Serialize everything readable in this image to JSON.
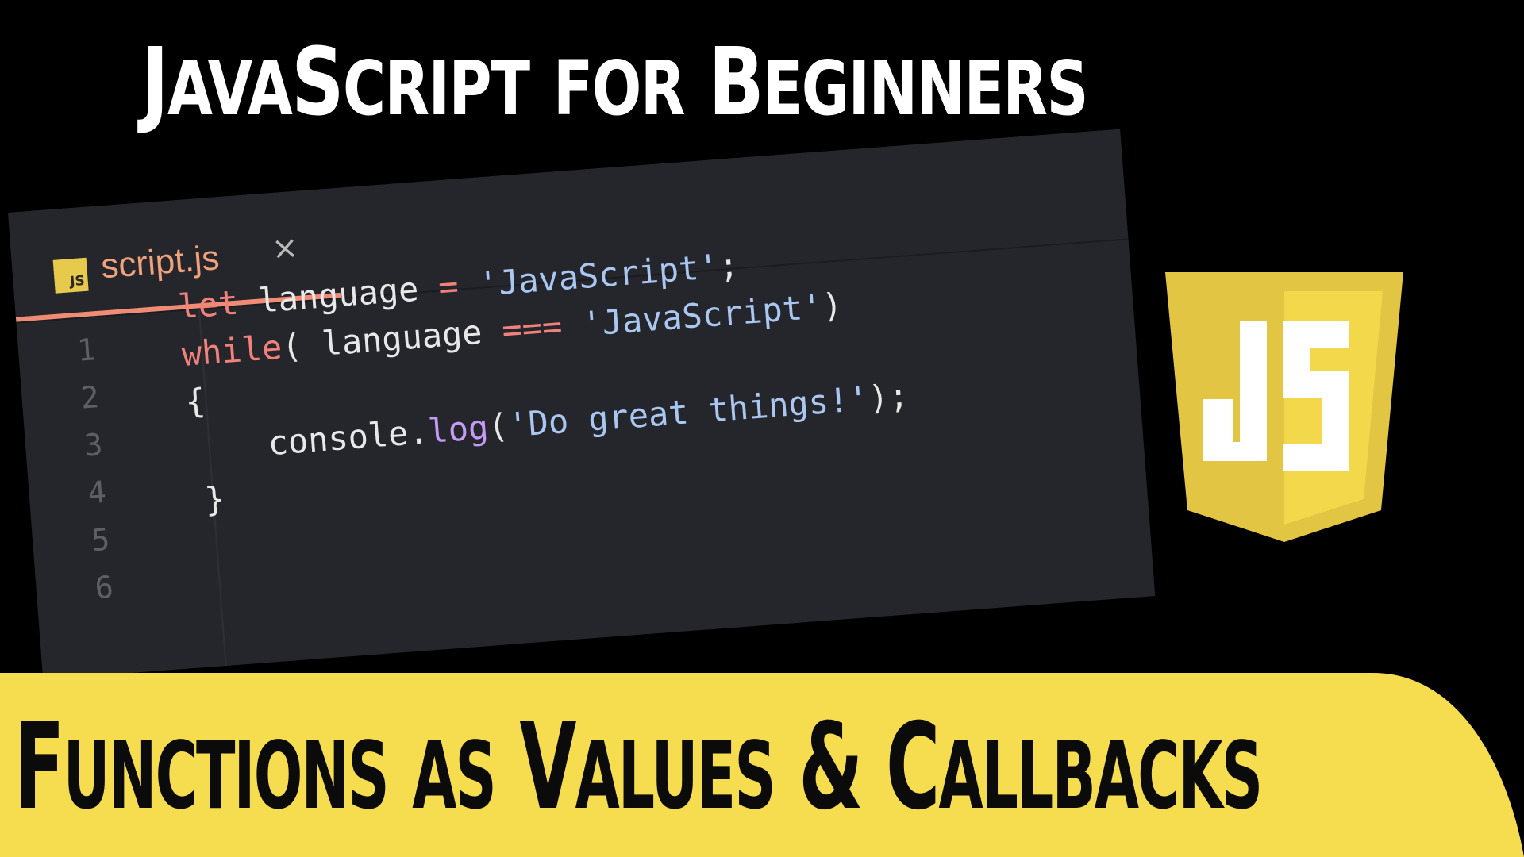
{
  "headline": {
    "parts": [
      "J",
      "ava",
      "S",
      "cript",
      " ",
      "for",
      " ",
      "B",
      "eginners"
    ]
  },
  "editor": {
    "tab": {
      "icon_text": "JS",
      "filename": "script.js",
      "close_glyph": "×"
    },
    "line_numbers": [
      "1",
      "2",
      "3",
      "4",
      "5",
      "6"
    ],
    "code": {
      "line1": {
        "kw": "let",
        "rest": " language ",
        "op": "=",
        "space": " ",
        "str": "'JavaScript'",
        "end": ";"
      },
      "line2": {
        "kw": "while",
        "open": "( language ",
        "op": "===",
        "space": " ",
        "str": "'JavaScript'",
        "end": ")"
      },
      "line3": "{",
      "line4": {
        "obj": "console.",
        "fn": "log",
        "open": "(",
        "str": "'Do great things!'",
        "end": ");"
      },
      "line5": "}"
    }
  },
  "logo": {
    "icon": "javascript-shield-icon",
    "letters": "JS"
  },
  "subtitle": {
    "parts": [
      "F",
      "unctions",
      " ",
      "as",
      " ",
      "V",
      "alues",
      " & ",
      "C",
      "allbacks"
    ]
  },
  "colors": {
    "background": "#000000",
    "banner_yellow": "#f5dd4f",
    "logo_yellow_dark": "#e1c543",
    "logo_yellow_light": "#f2d84a",
    "editor_bg": "#25262b",
    "tab_accent": "#f08c75",
    "keyword": "#f0817b",
    "string": "#a9c7f0",
    "function": "#c69bf5"
  }
}
